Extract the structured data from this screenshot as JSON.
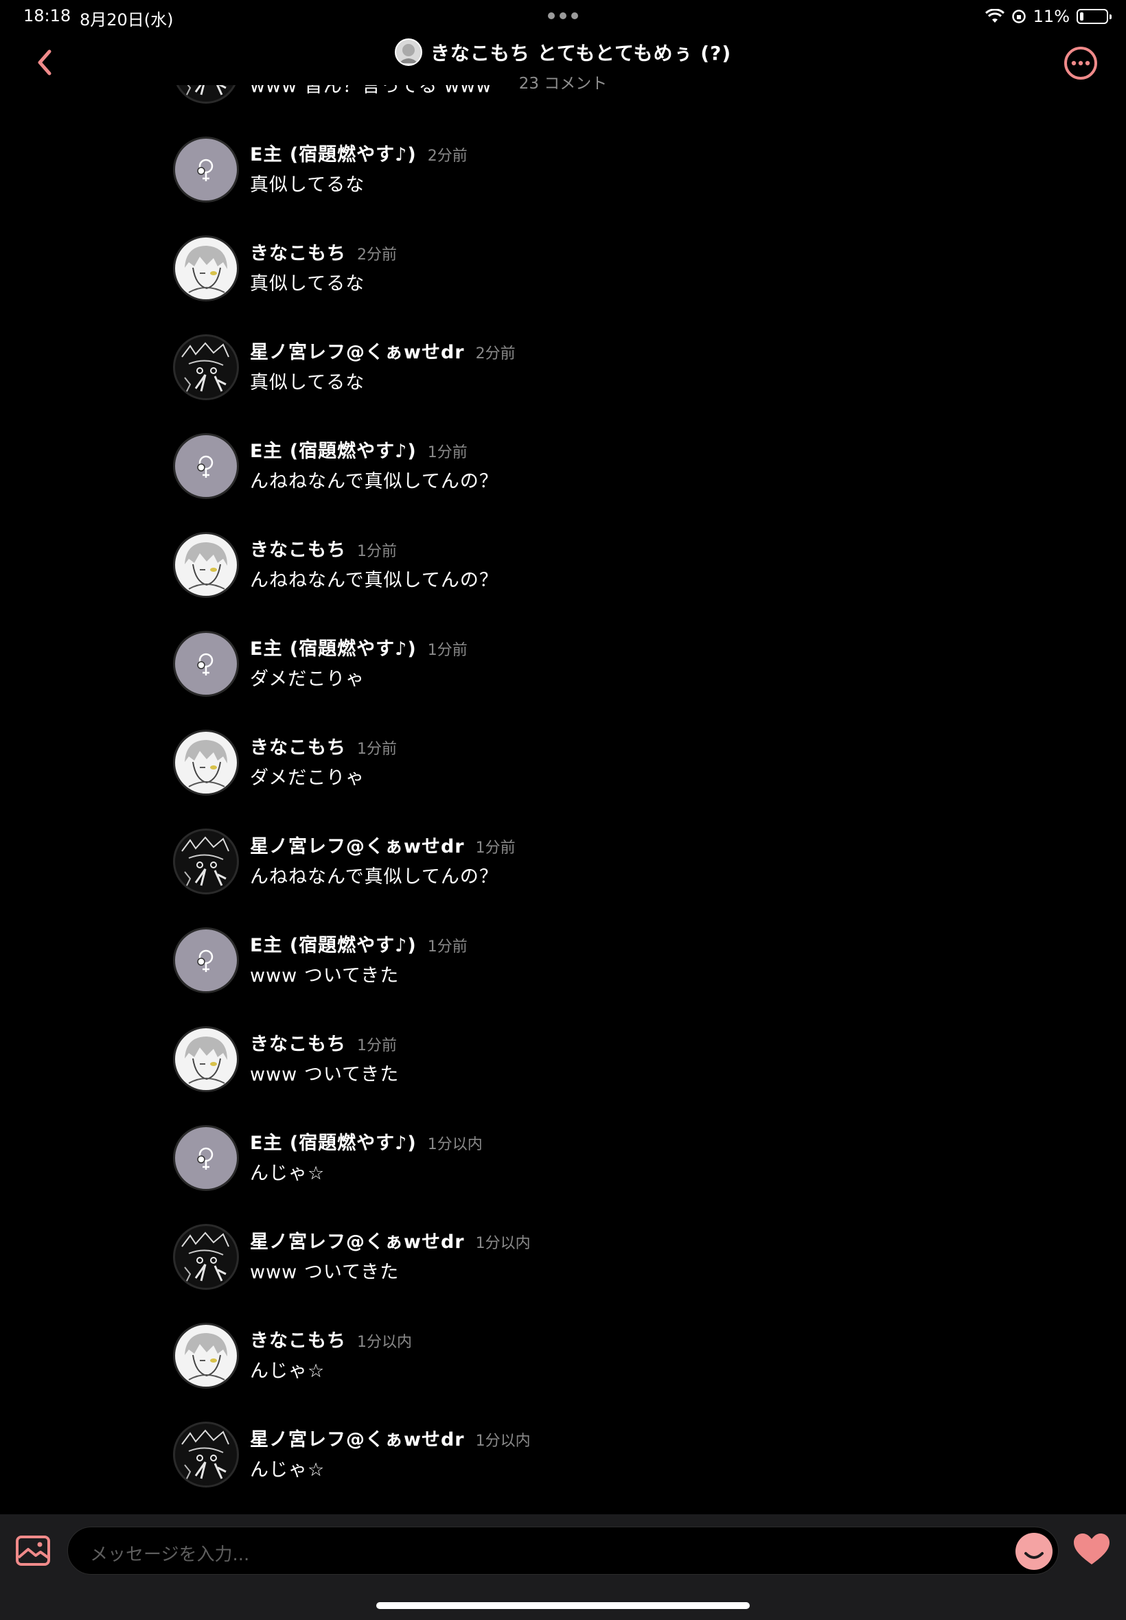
{
  "status_bar": {
    "time": "18:18",
    "date": "8月20日(水)",
    "battery": "11%"
  },
  "header": {
    "title": "きなこもち とてもとてもめぅ (?)",
    "subtitle": "23 コメント"
  },
  "messages": [
    {
      "name": "",
      "time": "",
      "text": "www 皆ん？言ってる www",
      "avatar": "dark"
    },
    {
      "name": "E主 (宿題燃やす♪)",
      "time": "2分前",
      "text": "真似してるな",
      "avatar": "gray"
    },
    {
      "name": "きなこもち",
      "time": "2分前",
      "text": "真似してるな",
      "avatar": "white"
    },
    {
      "name": "星ノ宮レフ@くぁwせdr",
      "time": "2分前",
      "text": "真似してるな",
      "avatar": "dark"
    },
    {
      "name": "E主 (宿題燃やす♪)",
      "time": "1分前",
      "text": "んねねなんで真似してんの？",
      "avatar": "gray"
    },
    {
      "name": "きなこもち",
      "time": "1分前",
      "text": "んねねなんで真似してんの？",
      "avatar": "white"
    },
    {
      "name": "E主 (宿題燃やす♪)",
      "time": "1分前",
      "text": "ダメだこりゃ",
      "avatar": "gray"
    },
    {
      "name": "きなこもち",
      "time": "1分前",
      "text": "ダメだこりゃ",
      "avatar": "white"
    },
    {
      "name": "星ノ宮レフ@くぁwせdr",
      "time": "1分前",
      "text": "んねねなんで真似してんの？",
      "avatar": "dark"
    },
    {
      "name": "E主 (宿題燃やす♪)",
      "time": "1分前",
      "text": "www ついてきた",
      "avatar": "gray"
    },
    {
      "name": "きなこもち",
      "time": "1分前",
      "text": "www ついてきた",
      "avatar": "white"
    },
    {
      "name": "E主 (宿題燃やす♪)",
      "time": "1分以内",
      "text": "んじゃ☆",
      "avatar": "gray"
    },
    {
      "name": "星ノ宮レフ@くぁwせdr",
      "time": "1分以内",
      "text": "www ついてきた",
      "avatar": "dark"
    },
    {
      "name": "きなこもち",
      "time": "1分以内",
      "text": "んじゃ☆",
      "avatar": "white"
    },
    {
      "name": "星ノ宮レフ@くぁwせdr",
      "time": "1分以内",
      "text": "んじゃ☆",
      "avatar": "dark"
    }
  ],
  "composer": {
    "placeholder": "メッセージを入力..."
  },
  "icons": {
    "back": "chevron-left-icon",
    "more": "ellipsis-circle-icon",
    "image": "image-icon",
    "emoji": "emoji-icon",
    "like": "heart-icon"
  },
  "colors": {
    "accent": "#f08a8a",
    "background": "#000000",
    "composer_bg": "#1c1c1e"
  }
}
